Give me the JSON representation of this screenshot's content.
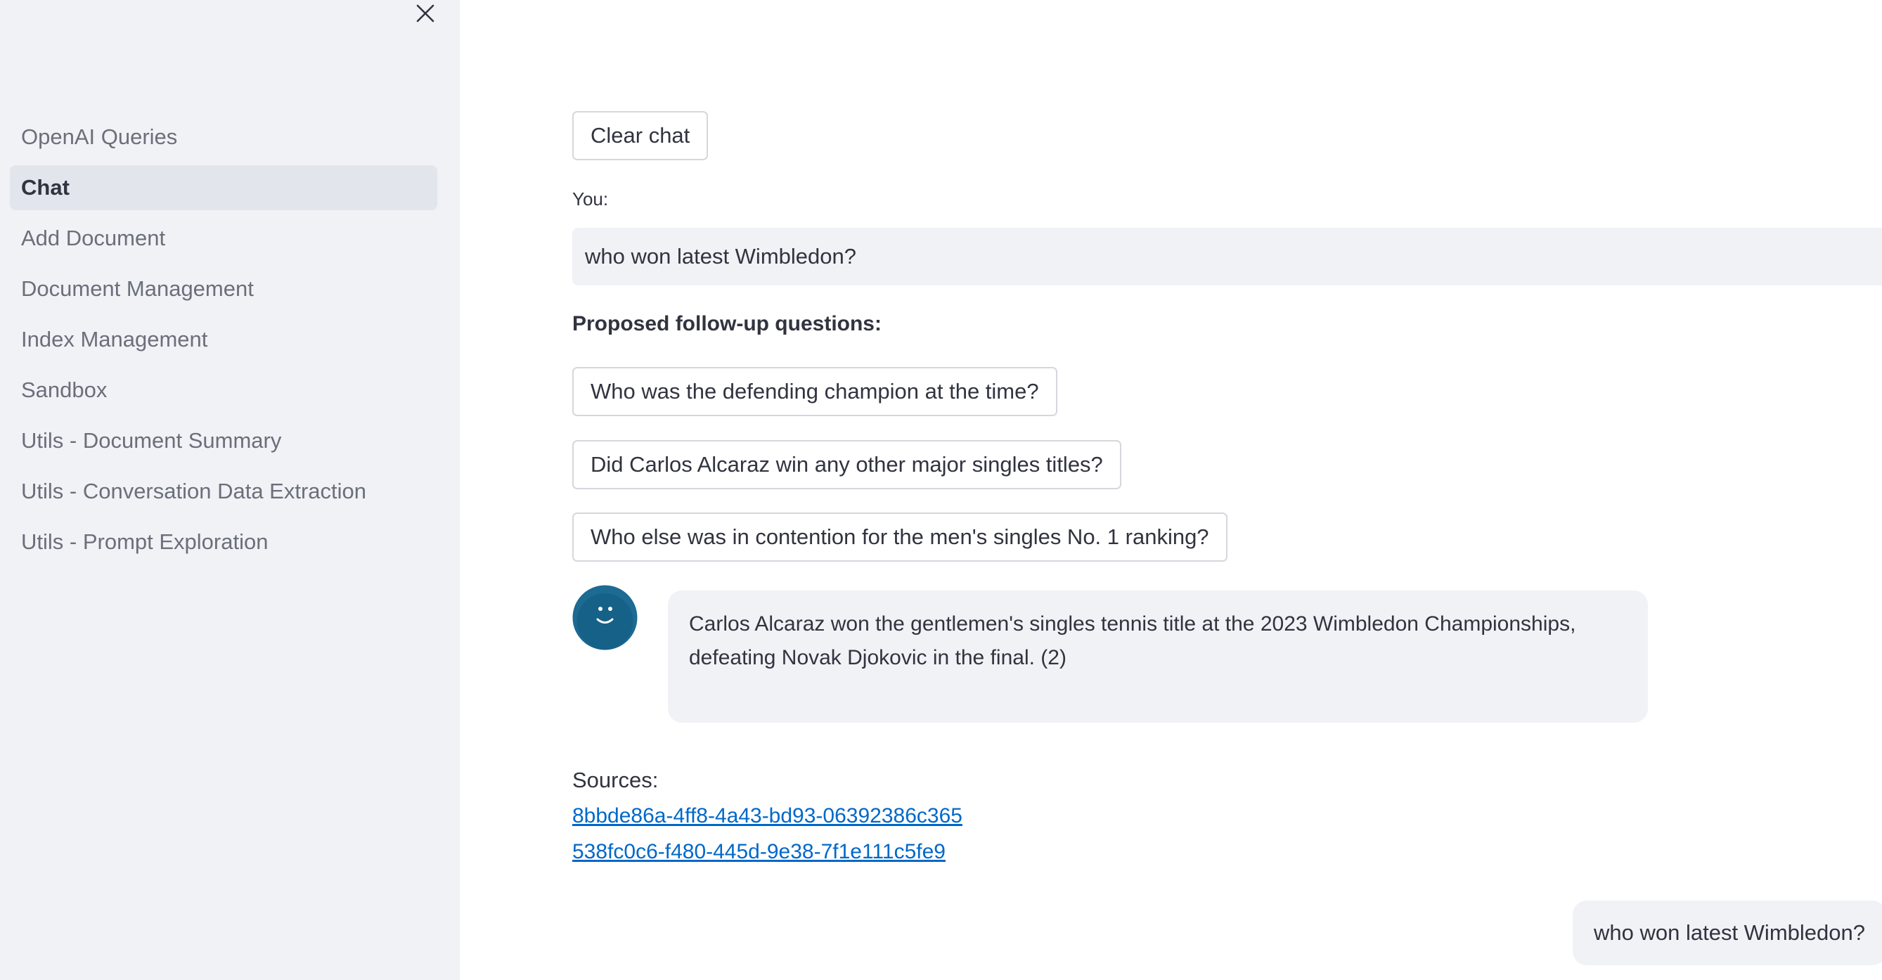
{
  "sidebar": {
    "close_icon": "close-icon",
    "items": [
      {
        "label": "OpenAI Queries",
        "active": false
      },
      {
        "label": "Chat",
        "active": true
      },
      {
        "label": "Add Document",
        "active": false
      },
      {
        "label": "Document Management",
        "active": false
      },
      {
        "label": "Index Management",
        "active": false
      },
      {
        "label": "Sandbox",
        "active": false
      },
      {
        "label": "Utils - Document Summary",
        "active": false
      },
      {
        "label": "Utils - Conversation Data Extraction",
        "active": false
      },
      {
        "label": "Utils - Prompt Exploration",
        "active": false
      }
    ]
  },
  "main": {
    "clear_chat_label": "Clear chat",
    "you_label": "You:",
    "you_input_value": "who won latest Wimbledon?",
    "followup_title": "Proposed follow-up questions:",
    "followups": [
      "Who was the defending champion at the time?",
      "Did Carlos Alcaraz win any other major singles titles?",
      "Who else was in contention for the men's singles No. 1 ranking?"
    ],
    "assistant_message": "Carlos Alcaraz won the gentlemen's singles tennis title at the 2023 Wimbledon Championships, defeating Novak Djokovic in the final. (2)",
    "sources_label": "Sources:",
    "sources": [
      "8bbde86a-4ff8-4a43-bd93-06392386c365",
      "538fc0c6-f480-445d-9e38-7f1e111c5fe9"
    ],
    "user_message": "who won latest Wimbledon?"
  },
  "colors": {
    "sidebar_bg": "#f0f2f6",
    "active_item_bg": "#e2e5ec",
    "link": "#0068c9",
    "avatar": "#1d6a92"
  }
}
